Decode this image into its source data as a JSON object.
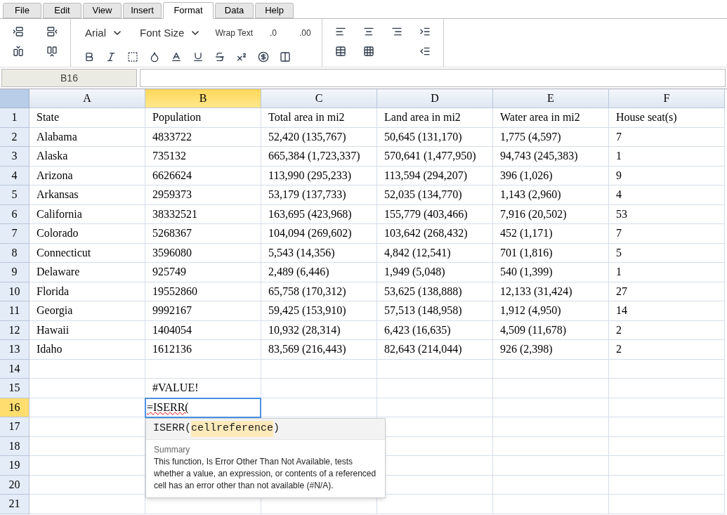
{
  "menu_tabs": [
    {
      "label": "File",
      "selected": false
    },
    {
      "label": "Edit",
      "selected": false
    },
    {
      "label": "View",
      "selected": false
    },
    {
      "label": "Insert",
      "selected": false
    },
    {
      "label": "Format",
      "selected": true
    },
    {
      "label": "Data",
      "selected": false
    },
    {
      "label": "Help",
      "selected": false
    }
  ],
  "toolbar": {
    "font_family": "Arial",
    "font_size": "Font Size",
    "wrap_text": "Wrap Text",
    "decrease_decimal": ".0",
    "increase_decimal": ".00"
  },
  "name_box": "B16",
  "columns": [
    {
      "label": "A",
      "selected": false
    },
    {
      "label": "B",
      "selected": true
    },
    {
      "label": "C",
      "selected": false
    },
    {
      "label": "D",
      "selected": false
    },
    {
      "label": "E",
      "selected": false
    },
    {
      "label": "F",
      "selected": false
    }
  ],
  "rows": [
    {
      "label": "1",
      "selected": false,
      "cells": [
        "State",
        "Population",
        "Total area in mi2",
        "Land area in mi2",
        "Water area in mi2",
        "House seat(s)"
      ]
    },
    {
      "label": "2",
      "selected": false,
      "cells": [
        "Alabama",
        "4833722",
        "52,420 (135,767)",
        "50,645 (131,170)",
        "1,775 (4,597)",
        "7"
      ]
    },
    {
      "label": "3",
      "selected": false,
      "cells": [
        "Alaska",
        "735132",
        "665,384 (1,723,337)",
        "570,641 (1,477,950)",
        "94,743 (245,383)",
        "1"
      ]
    },
    {
      "label": "4",
      "selected": false,
      "cells": [
        "Arizona",
        "6626624",
        "113,990 (295,233)",
        "113,594 (294,207)",
        "396 (1,026)",
        "9"
      ]
    },
    {
      "label": "5",
      "selected": false,
      "cells": [
        "Arkansas",
        "2959373",
        "53,179 (137,733)",
        "52,035 (134,770)",
        "1,143 (2,960)",
        "4"
      ]
    },
    {
      "label": "6",
      "selected": false,
      "cells": [
        "California",
        "38332521",
        "163,695 (423,968)",
        "155,779 (403,466)",
        "7,916 (20,502)",
        "53"
      ]
    },
    {
      "label": "7",
      "selected": false,
      "cells": [
        "Colorado",
        "5268367",
        "104,094 (269,602)",
        "103,642 (268,432)",
        "452 (1,171)",
        "7"
      ]
    },
    {
      "label": "8",
      "selected": false,
      "cells": [
        "Connecticut",
        "3596080",
        "5,543 (14,356)",
        "4,842 (12,541)",
        "701 (1,816)",
        "5"
      ]
    },
    {
      "label": "9",
      "selected": false,
      "cells": [
        "Delaware",
        "925749",
        "2,489 (6,446)",
        "1,949 (5,048)",
        "540 (1,399)",
        "1"
      ]
    },
    {
      "label": "10",
      "selected": false,
      "cells": [
        "Florida",
        "19552860",
        "65,758 (170,312)",
        "53,625 (138,888)",
        "12,133 (31,424)",
        "27"
      ]
    },
    {
      "label": "11",
      "selected": false,
      "cells": [
        "Georgia",
        "9992167",
        "59,425 (153,910)",
        "57,513 (148,958)",
        "1,912 (4,950)",
        "14"
      ]
    },
    {
      "label": "12",
      "selected": false,
      "cells": [
        "Hawaii",
        "1404054",
        "10,932 (28,314)",
        "6,423 (16,635)",
        "4,509 (11,678)",
        "2"
      ]
    },
    {
      "label": "13",
      "selected": false,
      "cells": [
        "Idaho",
        "1612136",
        "83,569 (216,443)",
        "82,643 (214,044)",
        "926 (2,398)",
        "2"
      ]
    },
    {
      "label": "14",
      "selected": false
    },
    {
      "label": "15",
      "selected": false,
      "cells": [
        null,
        "#VALUE!"
      ]
    },
    {
      "label": "16",
      "selected": true,
      "editor": "=ISERR("
    },
    {
      "label": "17",
      "selected": false
    },
    {
      "label": "18",
      "selected": false
    },
    {
      "label": "19",
      "selected": false
    },
    {
      "label": "20",
      "selected": false
    },
    {
      "label": "21",
      "selected": false
    }
  ],
  "function_tooltip": {
    "function_name": "ISERR(",
    "parameter": "cellreference",
    "closing": ")",
    "heading": "Summary",
    "description": "This function, Is Error Other Than Not Available, tests whether a value, an expression, or contents of a referenced cell has an error other than not available (#N/A)."
  }
}
